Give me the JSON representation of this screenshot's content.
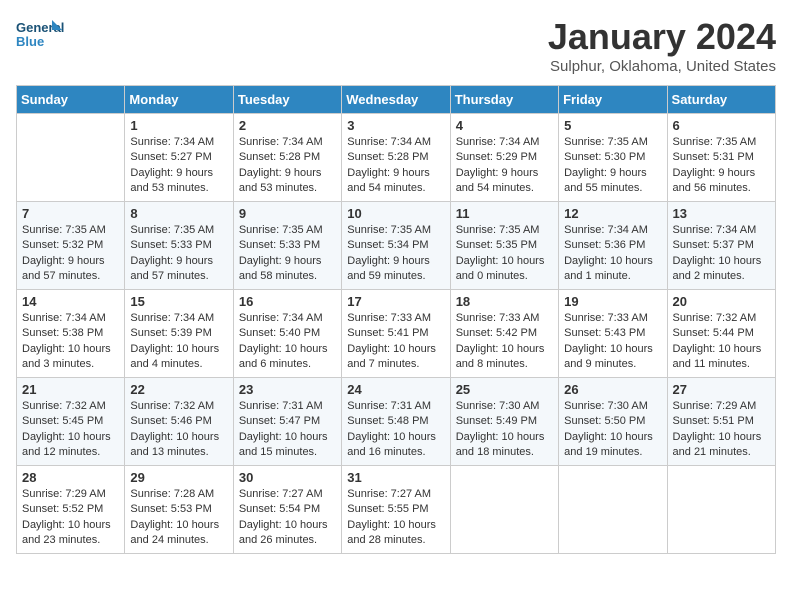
{
  "header": {
    "logo_line1": "General",
    "logo_line2": "Blue",
    "month": "January 2024",
    "location": "Sulphur, Oklahoma, United States"
  },
  "days_of_week": [
    "Sunday",
    "Monday",
    "Tuesday",
    "Wednesday",
    "Thursday",
    "Friday",
    "Saturday"
  ],
  "weeks": [
    [
      {
        "day": "",
        "info": ""
      },
      {
        "day": "1",
        "info": "Sunrise: 7:34 AM\nSunset: 5:27 PM\nDaylight: 9 hours\nand 53 minutes."
      },
      {
        "day": "2",
        "info": "Sunrise: 7:34 AM\nSunset: 5:28 PM\nDaylight: 9 hours\nand 53 minutes."
      },
      {
        "day": "3",
        "info": "Sunrise: 7:34 AM\nSunset: 5:28 PM\nDaylight: 9 hours\nand 54 minutes."
      },
      {
        "day": "4",
        "info": "Sunrise: 7:34 AM\nSunset: 5:29 PM\nDaylight: 9 hours\nand 54 minutes."
      },
      {
        "day": "5",
        "info": "Sunrise: 7:35 AM\nSunset: 5:30 PM\nDaylight: 9 hours\nand 55 minutes."
      },
      {
        "day": "6",
        "info": "Sunrise: 7:35 AM\nSunset: 5:31 PM\nDaylight: 9 hours\nand 56 minutes."
      }
    ],
    [
      {
        "day": "7",
        "info": "Sunrise: 7:35 AM\nSunset: 5:32 PM\nDaylight: 9 hours\nand 57 minutes."
      },
      {
        "day": "8",
        "info": "Sunrise: 7:35 AM\nSunset: 5:33 PM\nDaylight: 9 hours\nand 57 minutes."
      },
      {
        "day": "9",
        "info": "Sunrise: 7:35 AM\nSunset: 5:33 PM\nDaylight: 9 hours\nand 58 minutes."
      },
      {
        "day": "10",
        "info": "Sunrise: 7:35 AM\nSunset: 5:34 PM\nDaylight: 9 hours\nand 59 minutes."
      },
      {
        "day": "11",
        "info": "Sunrise: 7:35 AM\nSunset: 5:35 PM\nDaylight: 10 hours\nand 0 minutes."
      },
      {
        "day": "12",
        "info": "Sunrise: 7:34 AM\nSunset: 5:36 PM\nDaylight: 10 hours\nand 1 minute."
      },
      {
        "day": "13",
        "info": "Sunrise: 7:34 AM\nSunset: 5:37 PM\nDaylight: 10 hours\nand 2 minutes."
      }
    ],
    [
      {
        "day": "14",
        "info": "Sunrise: 7:34 AM\nSunset: 5:38 PM\nDaylight: 10 hours\nand 3 minutes."
      },
      {
        "day": "15",
        "info": "Sunrise: 7:34 AM\nSunset: 5:39 PM\nDaylight: 10 hours\nand 4 minutes."
      },
      {
        "day": "16",
        "info": "Sunrise: 7:34 AM\nSunset: 5:40 PM\nDaylight: 10 hours\nand 6 minutes."
      },
      {
        "day": "17",
        "info": "Sunrise: 7:33 AM\nSunset: 5:41 PM\nDaylight: 10 hours\nand 7 minutes."
      },
      {
        "day": "18",
        "info": "Sunrise: 7:33 AM\nSunset: 5:42 PM\nDaylight: 10 hours\nand 8 minutes."
      },
      {
        "day": "19",
        "info": "Sunrise: 7:33 AM\nSunset: 5:43 PM\nDaylight: 10 hours\nand 9 minutes."
      },
      {
        "day": "20",
        "info": "Sunrise: 7:32 AM\nSunset: 5:44 PM\nDaylight: 10 hours\nand 11 minutes."
      }
    ],
    [
      {
        "day": "21",
        "info": "Sunrise: 7:32 AM\nSunset: 5:45 PM\nDaylight: 10 hours\nand 12 minutes."
      },
      {
        "day": "22",
        "info": "Sunrise: 7:32 AM\nSunset: 5:46 PM\nDaylight: 10 hours\nand 13 minutes."
      },
      {
        "day": "23",
        "info": "Sunrise: 7:31 AM\nSunset: 5:47 PM\nDaylight: 10 hours\nand 15 minutes."
      },
      {
        "day": "24",
        "info": "Sunrise: 7:31 AM\nSunset: 5:48 PM\nDaylight: 10 hours\nand 16 minutes."
      },
      {
        "day": "25",
        "info": "Sunrise: 7:30 AM\nSunset: 5:49 PM\nDaylight: 10 hours\nand 18 minutes."
      },
      {
        "day": "26",
        "info": "Sunrise: 7:30 AM\nSunset: 5:50 PM\nDaylight: 10 hours\nand 19 minutes."
      },
      {
        "day": "27",
        "info": "Sunrise: 7:29 AM\nSunset: 5:51 PM\nDaylight: 10 hours\nand 21 minutes."
      }
    ],
    [
      {
        "day": "28",
        "info": "Sunrise: 7:29 AM\nSunset: 5:52 PM\nDaylight: 10 hours\nand 23 minutes."
      },
      {
        "day": "29",
        "info": "Sunrise: 7:28 AM\nSunset: 5:53 PM\nDaylight: 10 hours\nand 24 minutes."
      },
      {
        "day": "30",
        "info": "Sunrise: 7:27 AM\nSunset: 5:54 PM\nDaylight: 10 hours\nand 26 minutes."
      },
      {
        "day": "31",
        "info": "Sunrise: 7:27 AM\nSunset: 5:55 PM\nDaylight: 10 hours\nand 28 minutes."
      },
      {
        "day": "",
        "info": ""
      },
      {
        "day": "",
        "info": ""
      },
      {
        "day": "",
        "info": ""
      }
    ]
  ]
}
